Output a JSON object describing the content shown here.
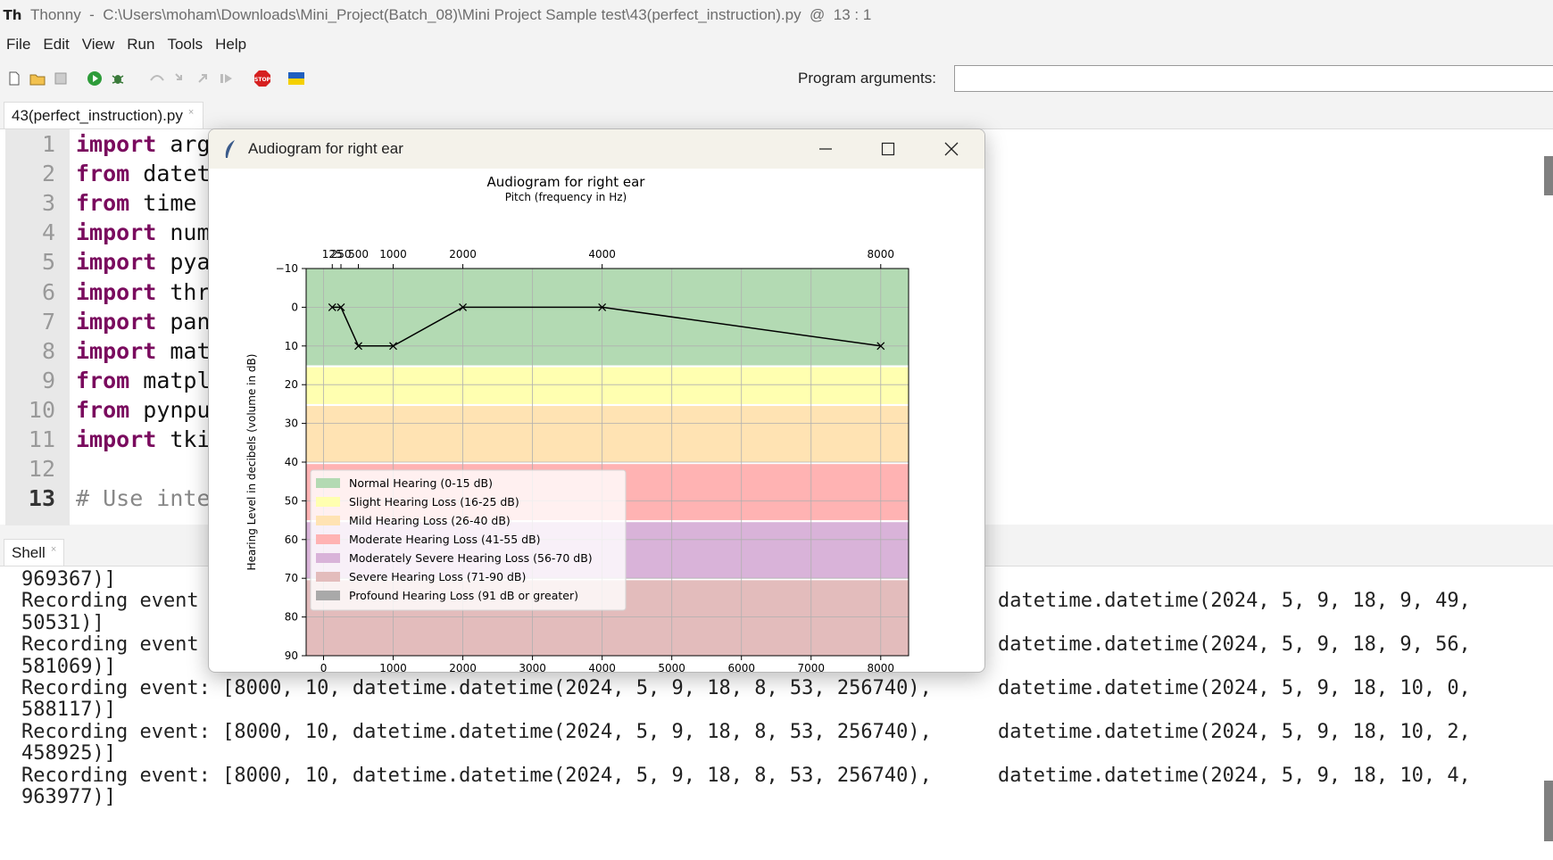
{
  "window": {
    "app_name": "Thonny",
    "title_path": "C:\\Users\\moham\\Downloads\\Mini_Project(Batch_08)\\Mini Project Sample test\\43(perfect_instruction).py",
    "cursor_pos": "13 : 1"
  },
  "menu": [
    "File",
    "Edit",
    "View",
    "Run",
    "Tools",
    "Help"
  ],
  "toolbar": {
    "icons": [
      "new-file-icon",
      "open-file-icon",
      "save-icon",
      "run-icon",
      "debug-icon",
      "step-over-icon",
      "step-into-icon",
      "step-out-icon",
      "resume-icon",
      "stop-icon",
      "ukraine-flag-icon"
    ],
    "args_label": "Program arguments:",
    "args_value": ""
  },
  "editor": {
    "tab_label": "43(perfect_instruction).py",
    "lines": [
      {
        "num": "1",
        "kw": "import",
        "rest": " arg"
      },
      {
        "num": "2",
        "kw": "from",
        "rest": " datet"
      },
      {
        "num": "3",
        "kw": "from",
        "rest": " time"
      },
      {
        "num": "4",
        "kw": "import",
        "rest": " num"
      },
      {
        "num": "5",
        "kw": "import",
        "rest": " pya"
      },
      {
        "num": "6",
        "kw": "import",
        "rest": " thr"
      },
      {
        "num": "7",
        "kw": "import",
        "rest": " pan"
      },
      {
        "num": "8",
        "kw": "import",
        "rest": " mat"
      },
      {
        "num": "9",
        "kw": "from",
        "rest": " matpl"
      },
      {
        "num": "10",
        "kw": "from",
        "rest": " pynpu"
      },
      {
        "num": "11",
        "kw": "import",
        "rest": " tki"
      },
      {
        "num": "12",
        "kw": "",
        "rest": ""
      },
      {
        "num": "13",
        "kw": "",
        "rest": "# Use inte"
      }
    ]
  },
  "shell": {
    "tab_label": "Shell",
    "lines": [
      {
        "left": "969367)]",
        "right": ""
      },
      {
        "left": "Recording event",
        "right": "datetime.datetime(2024, 5, 9, 18, 9, 49,"
      },
      {
        "left": "50531)]",
        "right": ""
      },
      {
        "left": "Recording event",
        "right": "datetime.datetime(2024, 5, 9, 18, 9, 56,"
      },
      {
        "left": "581069)]",
        "right": ""
      },
      {
        "left": "Recording event: [8000, 10, datetime.datetime(2024, 5, 9, 18, 8, 53, 256740),",
        "right": "datetime.datetime(2024, 5, 9, 18, 10, 0,"
      },
      {
        "left": "588117)]",
        "right": ""
      },
      {
        "left": "Recording event: [8000, 10, datetime.datetime(2024, 5, 9, 18, 8, 53, 256740),",
        "right": "datetime.datetime(2024, 5, 9, 18, 10, 2,"
      },
      {
        "left": "458925)]",
        "right": ""
      },
      {
        "left": "Recording event: [8000, 10, datetime.datetime(2024, 5, 9, 18, 8, 53, 256740),",
        "right": "datetime.datetime(2024, 5, 9, 18, 10, 4,"
      },
      {
        "left": "963977)]",
        "right": ""
      }
    ]
  },
  "dialog": {
    "title": "Audiogram for right ear"
  },
  "chart_data": {
    "type": "line",
    "title": "Audiogram for right ear",
    "top_xlabel": "Pitch (frequency in Hz)",
    "ylabel": "Hearing Level in decibels (volume in dB)",
    "xlim": [
      -250,
      8400
    ],
    "ylim": [
      90,
      -10
    ],
    "bottom_xticks": [
      "0",
      "1000",
      "2000",
      "3000",
      "4000",
      "5000",
      "6000",
      "7000",
      "8000"
    ],
    "top_xticks": [
      125,
      250,
      500,
      1000,
      2000,
      4000,
      8000
    ],
    "top_xtick_labels": [
      "125",
      "250",
      "500",
      "1000",
      "2000",
      "4000",
      "8000"
    ],
    "yticks": [
      -10,
      0,
      10,
      20,
      30,
      40,
      50,
      60,
      70,
      80,
      90
    ],
    "ytick_labels": [
      "−10",
      "0",
      "10",
      "20",
      "30",
      "40",
      "50",
      "60",
      "70",
      "80",
      "90"
    ],
    "grid": true,
    "legend_position": "lower left",
    "series": [
      {
        "x": [
          125,
          250,
          500,
          1000,
          2000,
          4000,
          8000
        ],
        "y": [
          0,
          0,
          10,
          10,
          0,
          0,
          10
        ],
        "color": "#000000",
        "marker": "x"
      }
    ],
    "bands": [
      {
        "label": "Normal Hearing (0-15 dB)",
        "from": -10,
        "to": 15,
        "color": "#b3dab3"
      },
      {
        "label": "Slight Hearing Loss (16-25 dB)",
        "from": 15.5,
        "to": 25,
        "color": "#ffffb0"
      },
      {
        "label": "Mild Hearing Loss (26-40 dB)",
        "from": 25.5,
        "to": 40,
        "color": "#ffe3b3"
      },
      {
        "label": "Moderate Hearing Loss (41-55 dB)",
        "from": 40.5,
        "to": 55,
        "color": "#ffb3b3"
      },
      {
        "label": "Moderately Severe Hearing Loss (56-70 dB)",
        "from": 55.5,
        "to": 70,
        "color": "#d9b3d9"
      },
      {
        "label": "Severe Hearing Loss (71-90 dB)",
        "from": 70.5,
        "to": 90,
        "color": "#e3bcbc"
      },
      {
        "label": "Profound Hearing Loss (91 dB or greater)",
        "from": 90,
        "to": 90,
        "color": "#a9a9a9"
      }
    ]
  }
}
